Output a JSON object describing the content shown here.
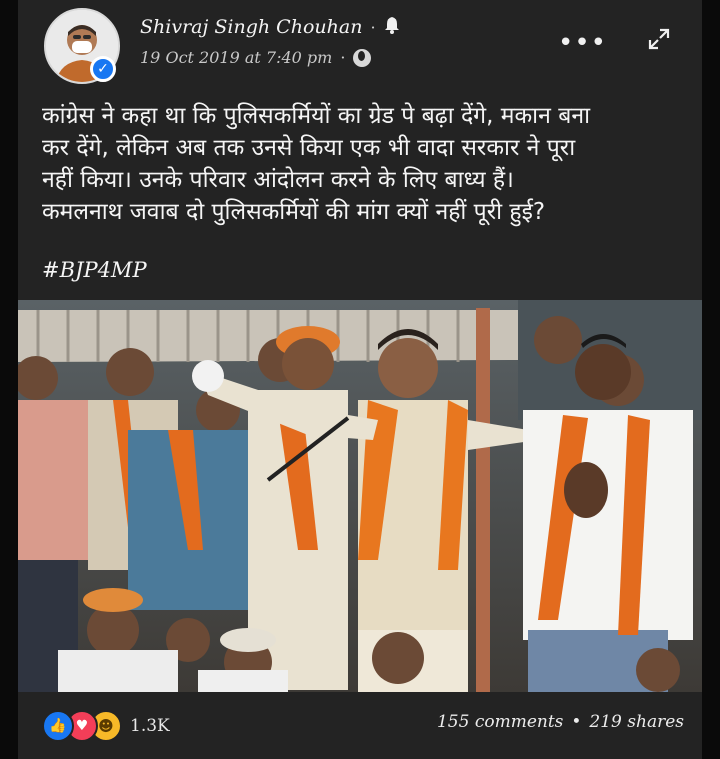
{
  "post": {
    "author": "Shivraj Singh Chouhan",
    "separator": "·",
    "timestamp": "19 Oct 2019 at 7:40 pm",
    "more_label": "•••",
    "expand_label": "↗↙",
    "text": "कांग्रेस ने कहा था कि पुलिसकर्मियों का ग्रेड पे बढ़ा देंगे, मकान बना\nकर देंगे, लेकिन अब तक उनसे किया एक भी वादा सरकार ने पूरा\nनहीं किया। उनके परिवार आंदोलन करने के लिए बाध्य हैं।\nकमलनाथ जवाब दो पुलिसकर्मियों की मांग क्यों नहीं पूरी हुई?",
    "hashtag": "#BJP4MP",
    "reaction_count": "1.3K",
    "comments": "155 comments",
    "shares": "219 shares",
    "stats_separator": "•"
  },
  "icons": {
    "verified": "verified-badge-icon",
    "bell": "bell-icon",
    "globe": "globe-icon",
    "like": "like-icon",
    "love": "love-icon",
    "haha": "haha-icon"
  },
  "colors": {
    "background": "#232323",
    "text": "#f5f5f5",
    "verified_blue": "#1877f2",
    "like_blue": "#1877f2",
    "love_red": "#f33e58",
    "haha_yellow": "#f7b928"
  }
}
